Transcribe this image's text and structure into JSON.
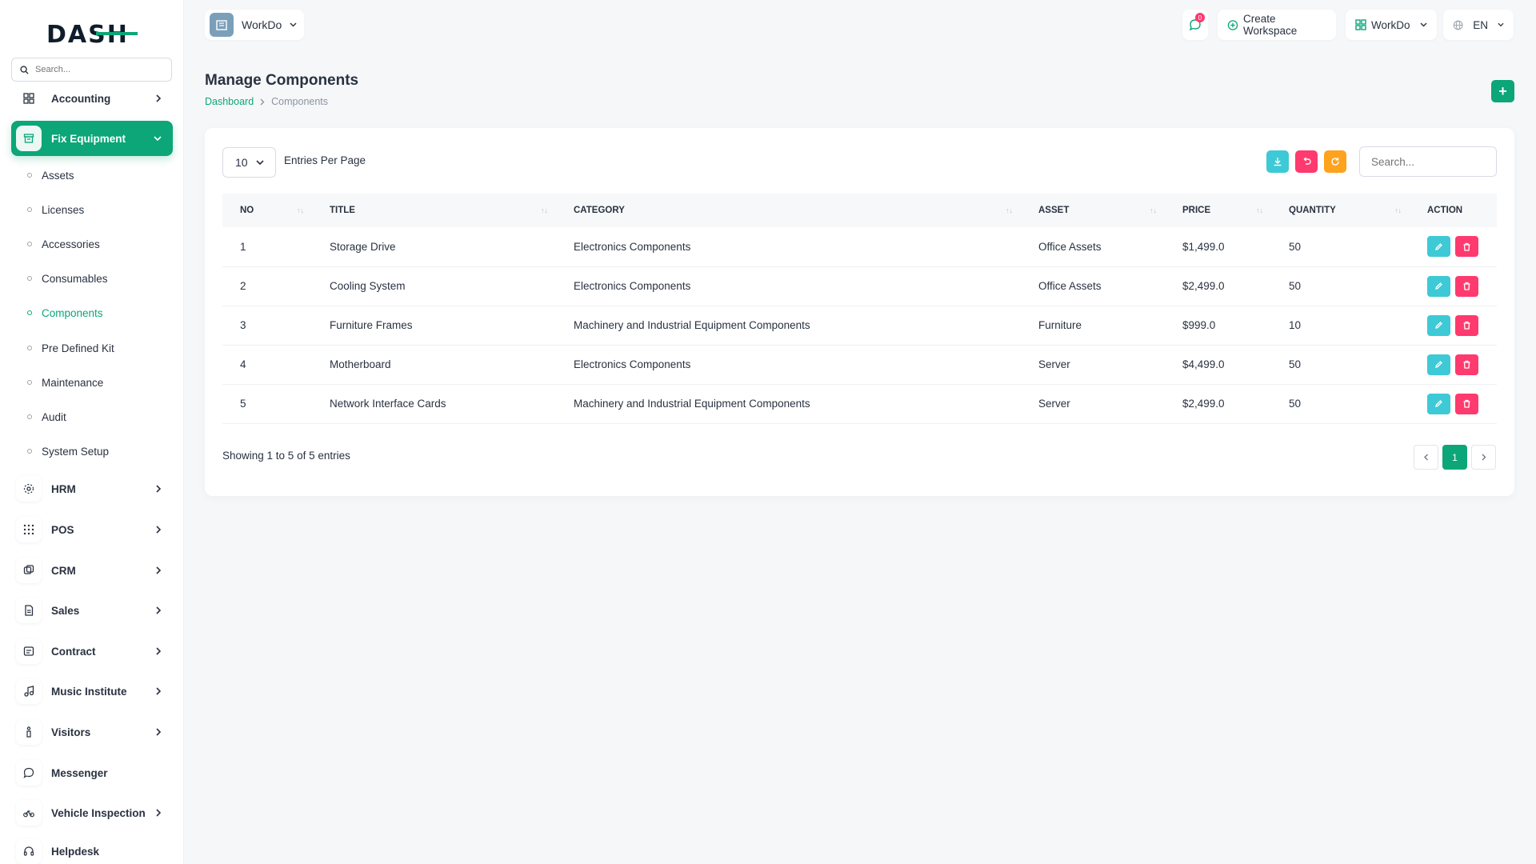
{
  "sidebar": {
    "logo_text": "DASH",
    "search_placeholder": "Search...",
    "accounting": "Accounting",
    "fix_equipment": "Fix Equipment",
    "sub_items": [
      "Assets",
      "Licenses",
      "Accessories",
      "Consumables",
      "Components",
      "Pre Defined Kit",
      "Maintenance",
      "Audit",
      "System Setup"
    ],
    "active_sub": "Components",
    "modules": [
      "HRM",
      "POS",
      "CRM",
      "Sales",
      "Contract",
      "Music Institute",
      "Visitors",
      "Messenger",
      "Vehicle Inspection",
      "Helpdesk"
    ],
    "accent_color": "#0ca678"
  },
  "topbar": {
    "workspace": "WorkDo",
    "notification_count": "0",
    "create_workspace": "Create Workspace",
    "workdo_menu": "WorkDo",
    "language": "EN"
  },
  "page": {
    "title": "Manage Components",
    "breadcrumb_home": "Dashboard",
    "breadcrumb_current": "Components",
    "add_button": "+"
  },
  "table": {
    "per_page_value": "10",
    "per_page_label": "Entries Per Page",
    "search_placeholder": "Search...",
    "columns": [
      "NO",
      "TITLE",
      "CATEGORY",
      "ASSET",
      "PRICE",
      "QUANTITY",
      "ACTION"
    ],
    "rows": [
      {
        "no": "1",
        "title": "Storage Drive",
        "category": "Electronics Components",
        "asset": "Office Assets",
        "price": "$1,499.0",
        "quantity": "50"
      },
      {
        "no": "2",
        "title": "Cooling System",
        "category": "Electronics Components",
        "asset": "Office Assets",
        "price": "$2,499.0",
        "quantity": "50"
      },
      {
        "no": "3",
        "title": "Furniture Frames",
        "category": "Machinery and Industrial Equipment Components",
        "asset": "Furniture",
        "price": "$999.0",
        "quantity": "10"
      },
      {
        "no": "4",
        "title": "Motherboard",
        "category": "Electronics Components",
        "asset": "Server",
        "price": "$4,499.0",
        "quantity": "50"
      },
      {
        "no": "5",
        "title": "Network Interface Cards",
        "category": "Machinery and Industrial Equipment Components",
        "asset": "Server",
        "price": "$2,499.0",
        "quantity": "50"
      }
    ],
    "showing": "Showing 1 to 5 of 5 entries",
    "current_page": "1"
  }
}
